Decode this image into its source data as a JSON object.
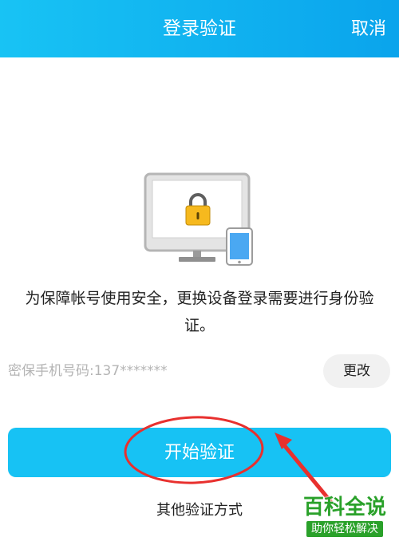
{
  "header": {
    "title": "登录验证",
    "cancel_label": "取消"
  },
  "illustration": {
    "icon": "monitor-lock-with-phone"
  },
  "message": {
    "text": "为保障帐号使用安全，更换设备登录需要进行身份验证。"
  },
  "phone": {
    "label": "密保手机号码:137*******",
    "change_label": "更改"
  },
  "actions": {
    "start_label": "开始验证",
    "other_label": "其他验证方式"
  },
  "watermark": {
    "main": "百科全说",
    "sub": "助你轻松解决"
  },
  "colors": {
    "accent": "#17c2f4",
    "header_start": "#18c3f4",
    "header_end": "#0aa4ec",
    "annotation": "#e8302e",
    "watermark": "#2aa12a"
  }
}
